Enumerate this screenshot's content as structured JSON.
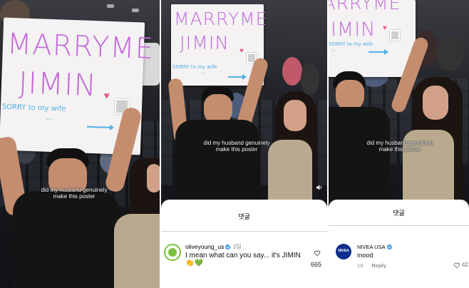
{
  "panels": [
    {
      "sign": {
        "line1": "MARRYME",
        "line2": "JIMIN",
        "subtitle": "SORRY to my wife",
        "sub_suffix": ")"
      },
      "caption": {
        "line1": "did my husband genuinely",
        "line2": "make this poster"
      }
    },
    {
      "sign": {
        "line1": "MARRYME",
        "line2": "JIMIN",
        "subtitle": "SORRY to my wife"
      },
      "caption": {
        "line1": "did my husband genuinely",
        "line2": "make this poster"
      },
      "comments_sheet": {
        "title": "댓글",
        "comment": {
          "username": "oliveyoung_us",
          "verified": true,
          "time": "3일",
          "text_line1": "I mean what can you say... it's JIMIN",
          "text_line2": "👏💚",
          "likes": "665"
        }
      }
    },
    {
      "sign": {
        "line1": "MARRYME",
        "line2": "JIMIN",
        "subtitle": "SORRY to my wife"
      },
      "caption": {
        "line1": "did my husband genuinely",
        "line2": "make this poster"
      },
      "comments_sheet": {
        "title": "댓글",
        "comment": {
          "username": "NIVEA USA",
          "verified": true,
          "avatar_text": "NIVEA",
          "text": "mood",
          "time": "1d",
          "reply_label": "Reply",
          "likes": "42"
        }
      }
    }
  ],
  "colors": {
    "sign_text": "#c36bd8",
    "sign_sub": "#4fb0e3",
    "nivea_blue": "#0b2d8c",
    "olive_green": "#7cbf3c",
    "verified": "#3897f0"
  },
  "icons": [
    "heart-icon",
    "volume-icon",
    "verified-badge-icon",
    "arrow-icon"
  ]
}
